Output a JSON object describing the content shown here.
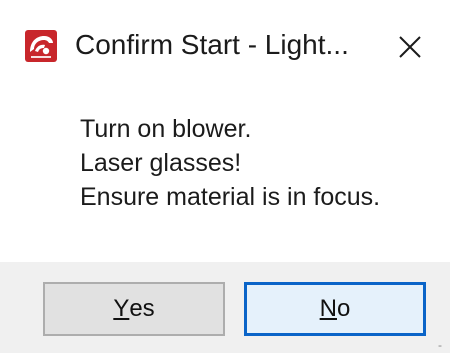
{
  "window": {
    "title": "Confirm Start - Light...",
    "icon": "app-logo-icon",
    "close_icon": "close-icon"
  },
  "message": {
    "lines": [
      "Turn on blower.",
      "Laser glasses!",
      "Ensure material is in focus."
    ]
  },
  "buttons": {
    "yes": {
      "mnemonic": "Y",
      "rest": "es"
    },
    "no": {
      "mnemonic": "N",
      "rest": "o"
    }
  },
  "colors": {
    "icon_bg": "#c8262b",
    "footer_bg": "#f0f0f0",
    "default_button_border": "#0a64c8"
  }
}
